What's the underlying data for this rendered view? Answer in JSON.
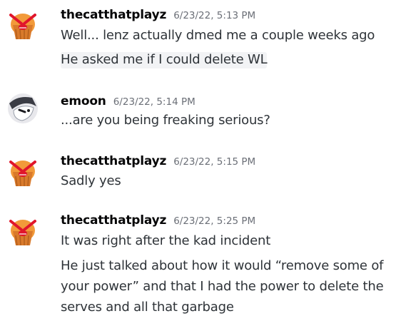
{
  "colors": {
    "background": "#ffffff",
    "username": "#060607",
    "timestamp": "#6b6f77",
    "text": "#2e3338",
    "highlight": "#f2f3f5"
  },
  "messages": [
    {
      "avatar_icon": "muffin-angry-avatar-icon",
      "username": "thecatthatplayz",
      "timestamp": "6/23/22, 5:13 PM",
      "lines": [
        "Well... lenz actually dmed me a couple weeks ago",
        "He asked me if I could delete WL"
      ]
    },
    {
      "avatar_icon": "ghost-mask-avatar-icon",
      "username": "emoon",
      "timestamp": "6/23/22, 5:14 PM",
      "lines": [
        "...are you being freaking serious?"
      ]
    },
    {
      "avatar_icon": "muffin-angry-avatar-icon",
      "username": "thecatthatplayz",
      "timestamp": "6/23/22, 5:15 PM",
      "lines": [
        "Sadly yes"
      ]
    },
    {
      "avatar_icon": "muffin-angry-avatar-icon",
      "username": "thecatthatplayz",
      "timestamp": "6/23/22, 5:25 PM",
      "lines": [
        "It was right after the kad incident",
        "He just talked about how it would “remove some of",
        "your power” and that I had the power to delete the",
        "serves and all that garbage"
      ]
    }
  ]
}
